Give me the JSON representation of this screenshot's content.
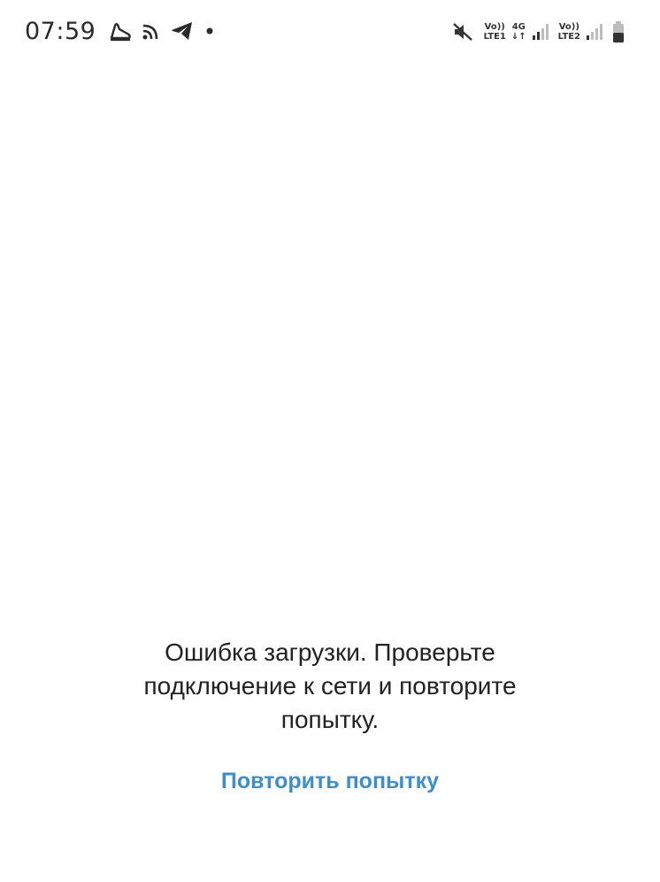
{
  "status_bar": {
    "time": "07:59",
    "left_icons": [
      "shoe-icon",
      "cast-icon",
      "telegram-icon",
      "dot-icon"
    ],
    "sim1": {
      "top": "Vo))",
      "bottom": "LTE1"
    },
    "data": {
      "top": "4G",
      "bottom": "↓↑"
    },
    "sim2": {
      "top": "Vo))",
      "bottom": "LTE2"
    },
    "right_icons": [
      "mute-icon",
      "signal-icon",
      "battery-icon"
    ]
  },
  "content": {
    "error_message": "Ошибка загрузки. Проверьте подключение к сети и повторите попытку.",
    "retry_label": "Повторить попытку"
  },
  "colors": {
    "background": "#ffffff",
    "text": "#222222",
    "accent": "#3d8ec9"
  }
}
